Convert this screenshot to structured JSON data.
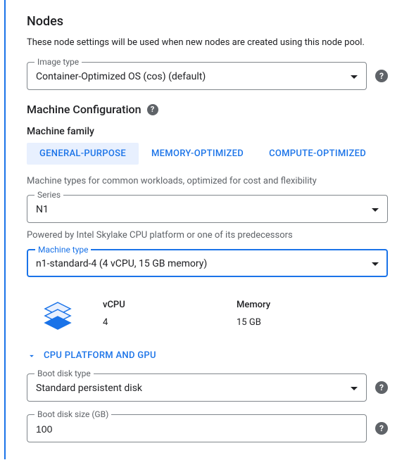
{
  "heading": "Nodes",
  "description": "These node settings will be used when new nodes are created using this node pool.",
  "imageType": {
    "label": "Image type",
    "value": "Container-Optimized OS (cos) (default)"
  },
  "machineConfig": {
    "title": "Machine Configuration",
    "familyLabel": "Machine family",
    "tabs": {
      "general": "GENERAL-PURPOSE",
      "memory": "MEMORY-OPTIMIZED",
      "compute": "COMPUTE-OPTIMIZED"
    },
    "familyHint": "Machine types for common workloads, optimized for cost and flexibility",
    "series": {
      "label": "Series",
      "value": "N1",
      "hint": "Powered by Intel Skylake CPU platform or one of its predecessors"
    },
    "machineType": {
      "label": "Machine type",
      "value": "n1-standard-4 (4 vCPU, 15 GB memory)"
    },
    "specs": {
      "vcpuLabel": "vCPU",
      "vcpuValue": "4",
      "memoryLabel": "Memory",
      "memoryValue": "15 GB"
    },
    "expander": "CPU PLATFORM AND GPU"
  },
  "bootDiskType": {
    "label": "Boot disk type",
    "value": "Standard persistent disk"
  },
  "bootDiskSize": {
    "label": "Boot disk size (GB)",
    "value": "100"
  }
}
